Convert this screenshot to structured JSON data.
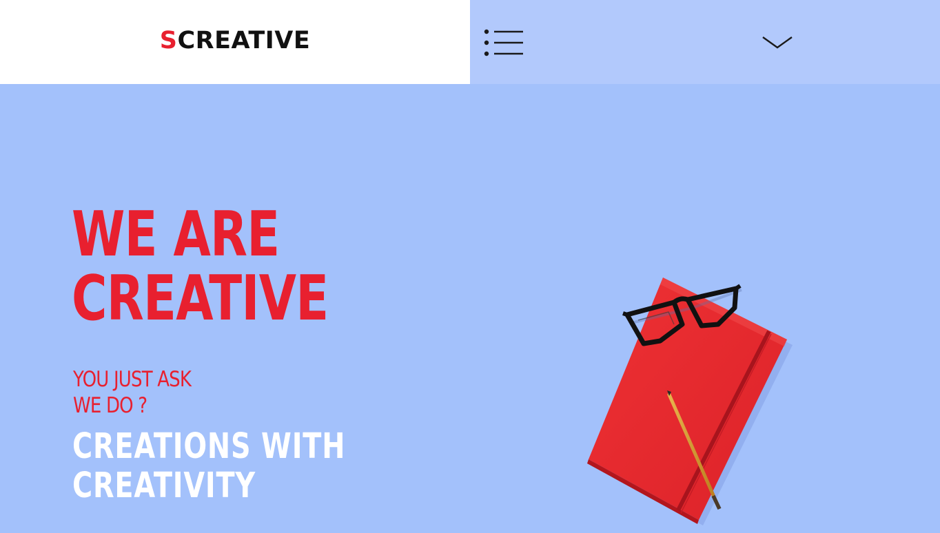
{
  "header": {
    "logo_first": "S",
    "logo_rest": "CREATIVE"
  },
  "icons": {
    "menu": "list-menu-icon",
    "dropdown": "chevron-down-icon"
  },
  "hero": {
    "title_line1": "WE ARE",
    "title_line2": "CREATIVE",
    "subtitle_line1": "YOU JUST ASK",
    "subtitle_line2": "WE DO ?",
    "tagline_line1": "CREATIONS WITH",
    "tagline_line2": "CREATIVITY"
  },
  "colors": {
    "accent_red": "#e8202f",
    "background_blue": "#a3c1fb",
    "nav_blue": "#b2c9fc",
    "header_white": "#ffffff",
    "text_dark": "#111111"
  }
}
